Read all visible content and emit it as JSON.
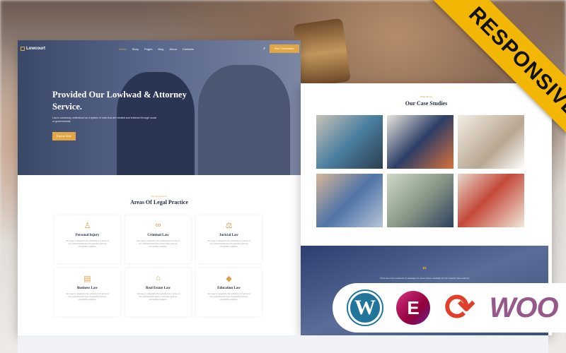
{
  "ribbon": "RESPONSIVE",
  "left": {
    "nav": {
      "logo": "Lowcourt",
      "items": [
        "Home",
        "Story",
        "Pages",
        "Blog",
        "About",
        "Contacts"
      ],
      "cta": "Free Consultation"
    },
    "hero": {
      "title": "Provided Our Lowlwad & Attorney Service.",
      "body": "Law is commonly understood as a system of rules that are created and enforced through social or governmental.",
      "button": "Explore More"
    },
    "practice": {
      "subtitle": "We Are Expert In",
      "title": "Areas Of Legal Practice",
      "cards": [
        {
          "icon": "lawyer-icon",
          "title": "Personal Injury",
          "text": "One way to categorize the activities is in terms of the professional's area of expertise such as competitive analysis."
        },
        {
          "icon": "handcuffs-icon",
          "title": "Criminal Law",
          "text": "One way to categorize the activities is in terms of the professional's area of expertise such as competitive analysis."
        },
        {
          "icon": "scales-icon",
          "title": "Juricial Law",
          "text": "One way to categorize the activities is in terms of the professional's area of expertise such as competitive analysis."
        },
        {
          "icon": "document-icon",
          "title": "Business Law",
          "text": "One way to categorize the activities is in terms of the professional's area of expertise such as competitive analysis."
        },
        {
          "icon": "house-icon",
          "title": "Real Estate Law",
          "text": "One way to categorize the activities is in terms of the professional's area of expertise such as competitive analysis."
        },
        {
          "icon": "graduation-cap-icon",
          "title": "Education Law",
          "text": "One way to categorize the activities is in terms of the professional's area of expertise such as competitive analysis."
        }
      ]
    }
  },
  "right": {
    "subtitle": "What We Do",
    "title": "Our Case Studies",
    "quote": "There are many variations of passages of Lorem Ipsum available but the majority have suffered"
  },
  "badges": {
    "woo": "WOO"
  },
  "colors": {
    "accent": "#e1a645",
    "navy": "#1f2a44",
    "ribbon": "#f2b705"
  }
}
